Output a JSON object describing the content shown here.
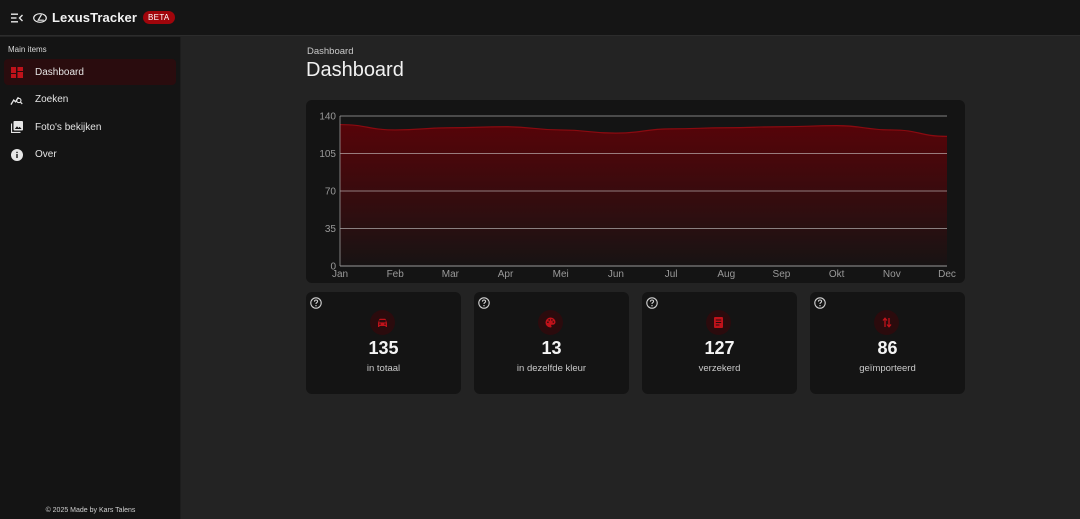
{
  "app": {
    "brand": "LexusTracker",
    "badge": "BETA"
  },
  "sidebar": {
    "section_label": "Main items",
    "items": [
      {
        "label": "Dashboard",
        "icon": "dashboard-icon",
        "active": true
      },
      {
        "label": "Zoeken",
        "icon": "search-car-icon",
        "active": false
      },
      {
        "label": "Foto's bekijken",
        "icon": "photo-library-icon",
        "active": false
      },
      {
        "label": "Over",
        "icon": "info-icon",
        "active": false
      }
    ],
    "footer": "© 2025 Made by Kars Talens"
  },
  "page": {
    "breadcrumb": "Dashboard",
    "title": "Dashboard"
  },
  "chart_data": {
    "type": "area",
    "categories": [
      "Jan",
      "Feb",
      "Mar",
      "Apr",
      "Mei",
      "Jun",
      "Jul",
      "Aug",
      "Sep",
      "Okt",
      "Nov",
      "Dec"
    ],
    "values": [
      132,
      127,
      129,
      130,
      127,
      124,
      128,
      129,
      130,
      131,
      127,
      121
    ],
    "ylim": [
      0,
      140
    ],
    "yticks": [
      0,
      35,
      70,
      105,
      140
    ],
    "grid": true,
    "colors": {
      "line": "#8a0a10",
      "fill_top": "#5a0308",
      "grid": "#d8d8d8"
    }
  },
  "stats": [
    {
      "value": "135",
      "label": "in totaal",
      "icon": "car-icon"
    },
    {
      "value": "13",
      "label": "in dezelfde kleur",
      "icon": "palette-icon"
    },
    {
      "value": "127",
      "label": "verzekerd",
      "icon": "document-icon"
    },
    {
      "value": "86",
      "label": "geïmporteerd",
      "icon": "import-arrows-icon"
    }
  ],
  "colors": {
    "accent": "#c0121a",
    "background": "#232323",
    "card": "#141414"
  }
}
